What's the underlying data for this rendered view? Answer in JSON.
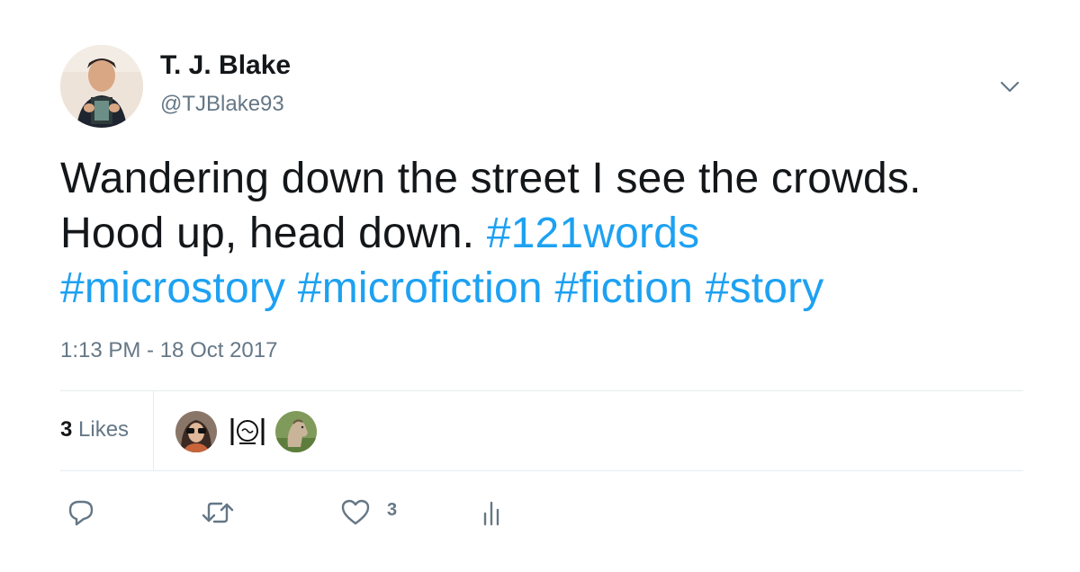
{
  "author": {
    "display_name": "T. J. Blake",
    "handle": "@TJBlake93"
  },
  "tweet": {
    "text_plain": "Wandering down the street I see the crowds. Hood up, head down.",
    "hashtags": [
      "#121words",
      "#microstory",
      "#microfiction",
      "#fiction",
      "#story"
    ],
    "timestamp": "1:13 PM - 18 Oct 2017"
  },
  "stats": {
    "likes_number": "3",
    "likes_label": "Likes",
    "liker_avatars": [
      "liker-avatar-woman",
      "liker-avatar-121words-logo",
      "liker-avatar-horse"
    ]
  },
  "actions": {
    "reply_icon": "reply-icon",
    "retweet_icon": "retweet-icon",
    "like_icon": "heart-icon",
    "like_count": "3",
    "analytics_icon": "analytics-icon"
  },
  "colors": {
    "link": "#1da1f2",
    "text": "#14171a",
    "secondary": "#657786",
    "divider": "#e6ecf0"
  }
}
